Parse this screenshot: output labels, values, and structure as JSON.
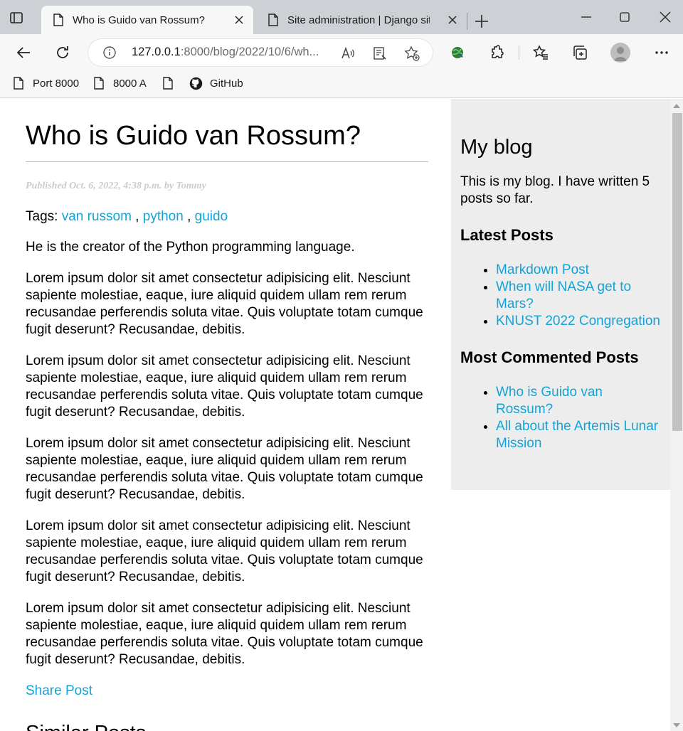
{
  "browser": {
    "tabs": [
      {
        "title": "Who is Guido van Rossum?",
        "active": true
      },
      {
        "title": "Site administration | Django site admin",
        "active": false
      }
    ],
    "address": {
      "host": "127.0.0.1",
      "rest": ":8000/blog/2022/10/6/wh..."
    },
    "favorites": [
      {
        "label": "Port 8000",
        "icon": "page-icon"
      },
      {
        "label": "8000 A",
        "icon": "page-icon"
      },
      {
        "label": "",
        "icon": "page-icon"
      },
      {
        "label": "GitHub",
        "icon": "github-icon"
      }
    ]
  },
  "post": {
    "title": "Who is Guido van Rossum?",
    "meta": "Published Oct. 6, 2022, 4:38 p.m. by Tommy",
    "tags_label": "Tags: ",
    "tags": [
      "van russom",
      "python",
      "guido"
    ],
    "tag_separator": " , ",
    "intro": "He is the creator of the Python programming language.",
    "paragraphs": [
      "Lorem ipsum dolor sit amet consectetur adipisicing elit. Nesciunt sapiente molestiae, eaque, iure aliquid quidem ullam rem rerum recusandae perferendis soluta vitae. Quis voluptate totam cumque fugit deserunt? Recusandae, debitis.",
      "Lorem ipsum dolor sit amet consectetur adipisicing elit. Nesciunt sapiente molestiae, eaque, iure aliquid quidem ullam rem rerum recusandae perferendis soluta vitae. Quis voluptate totam cumque fugit deserunt? Recusandae, debitis.",
      "Lorem ipsum dolor sit amet consectetur adipisicing elit. Nesciunt sapiente molestiae, eaque, iure aliquid quidem ullam rem rerum recusandae perferendis soluta vitae. Quis voluptate totam cumque fugit deserunt? Recusandae, debitis.",
      "Lorem ipsum dolor sit amet consectetur adipisicing elit. Nesciunt sapiente molestiae, eaque, iure aliquid quidem ullam rem rerum recusandae perferendis soluta vitae. Quis voluptate totam cumque fugit deserunt? Recusandae, debitis.",
      "Lorem ipsum dolor sit amet consectetur adipisicing elit. Nesciunt sapiente molestiae, eaque, iure aliquid quidem ullam rem rerum recusandae perferendis soluta vitae. Quis voluptate totam cumque fugit deserunt? Recusandae, debitis."
    ],
    "share_label": "Share Post",
    "similar_heading": "Similar Posts"
  },
  "sidebar": {
    "title": "My blog",
    "description": "This is my blog. I have written 5 posts so far.",
    "latest_heading": "Latest Posts",
    "latest": [
      "Markdown Post",
      "When will NASA get to Mars?",
      "KNUST 2022 Congregation"
    ],
    "most_commented_heading": "Most Commented Posts",
    "most_commented": [
      "Who is Guido van Rossum?",
      "All about the Artemis Lunar Mission"
    ]
  },
  "colors": {
    "link": "#12a3d7",
    "sidebar_bg": "#ededed",
    "tabstrip_bg": "#cdd0d4"
  }
}
